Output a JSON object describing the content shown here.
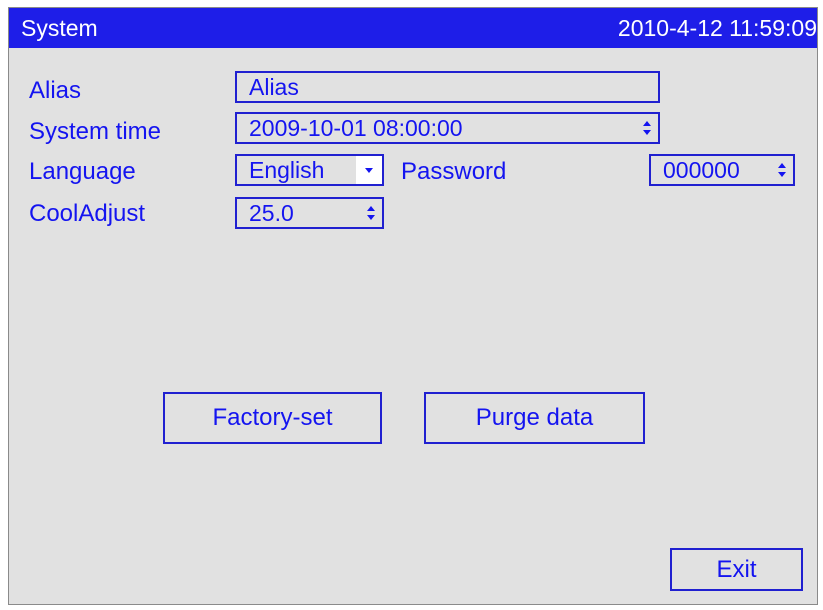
{
  "title_bar": {
    "title": "System",
    "datetime": "2010-4-12 11:59:09"
  },
  "form": {
    "alias": {
      "label": "Alias",
      "value": "Alias"
    },
    "system_time": {
      "label": "System time",
      "value": "2009-10-01 08:00:00"
    },
    "language": {
      "label": "Language",
      "value": "English"
    },
    "password": {
      "label": "Password",
      "value": "000000"
    },
    "cool_adjust": {
      "label": "CoolAdjust",
      "value": "25.0"
    }
  },
  "buttons": {
    "factory_set": "Factory-set",
    "purge_data": "Purge data",
    "exit": "Exit"
  },
  "icons": {
    "spinner": "up-down-spinner-icon",
    "dropdown": "dropdown-arrow-icon"
  },
  "colors": {
    "title_bar_bg": "#1e1ee8",
    "text": "#1414f0",
    "panel_bg": "#e1e1e1"
  }
}
